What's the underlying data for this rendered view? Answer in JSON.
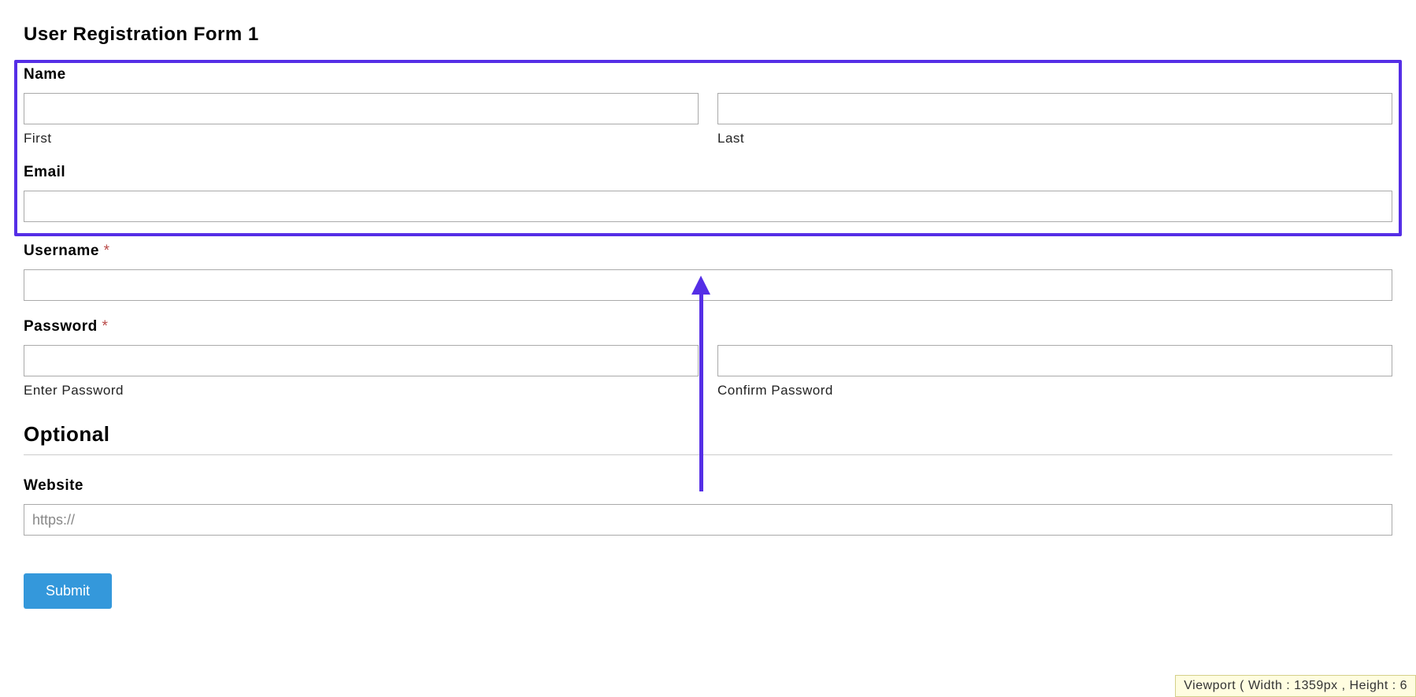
{
  "title": "User Registration Form 1",
  "fields": {
    "name": {
      "label": "Name",
      "first_sublabel": "First",
      "last_sublabel": "Last"
    },
    "email": {
      "label": "Email"
    },
    "username": {
      "label": "Username ",
      "required_mark": "*"
    },
    "password": {
      "label": "Password ",
      "required_mark": "*",
      "enter_sublabel": "Enter Password",
      "confirm_sublabel": "Confirm Password"
    }
  },
  "optional_section": {
    "heading": "Optional",
    "website": {
      "label": "Website",
      "placeholder": "https://"
    }
  },
  "submit_label": "Submit",
  "viewport_text": "Viewport ( Width : 1359px , Height : 6",
  "annotation": {
    "highlight_color": "#552ee6"
  }
}
